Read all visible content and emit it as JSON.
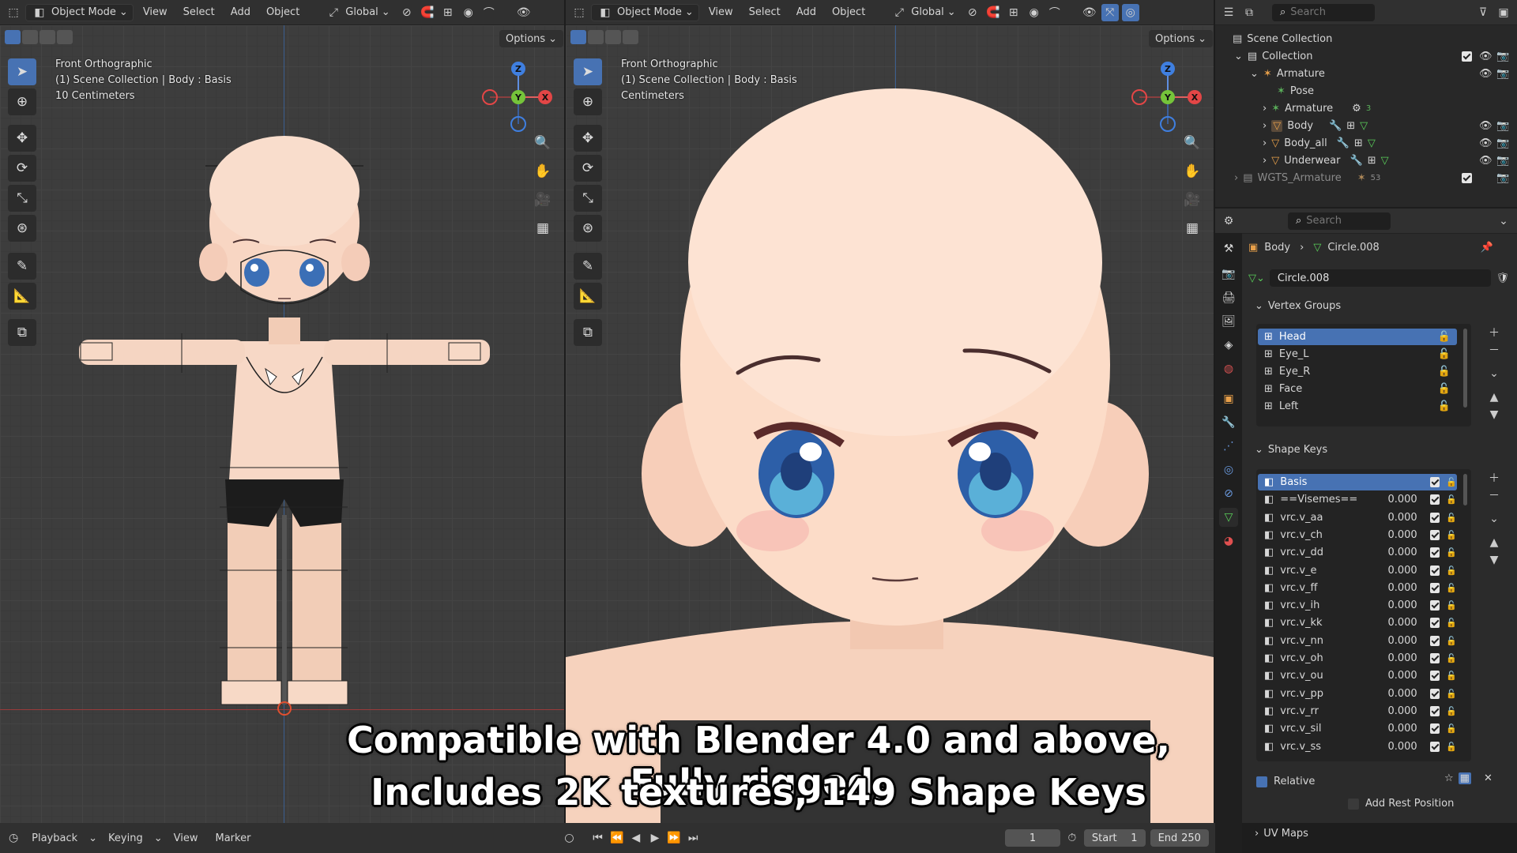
{
  "viewport_left": {
    "mode": "Object Mode",
    "menus": [
      "View",
      "Select",
      "Add",
      "Object"
    ],
    "orientation": "Global",
    "options_label": "Options",
    "overlay_lines": [
      "Front Orthographic",
      "(1) Scene Collection | Body : Basis",
      "10 Centimeters"
    ]
  },
  "viewport_right": {
    "mode": "Object Mode",
    "menus": [
      "View",
      "Select",
      "Add",
      "Object"
    ],
    "orientation": "Global",
    "options_label": "Options",
    "overlay_lines": [
      "Front Orthographic",
      "(1) Scene Collection | Body : Basis",
      "Centimeters"
    ]
  },
  "gizmo": {
    "z": "Z",
    "y": "Y",
    "x": "X"
  },
  "outliner": {
    "search_placeholder": "Search",
    "rows": [
      {
        "label": "Scene Collection",
        "icon": "scene-collection-icon"
      },
      {
        "label": "Collection",
        "icon": "collection-icon"
      },
      {
        "label": "Armature",
        "icon": "armature-icon"
      },
      {
        "label": "Pose",
        "icon": "pose-icon"
      },
      {
        "label": "Armature",
        "icon": "armature-data-icon",
        "badge": "3"
      },
      {
        "label": "Body",
        "icon": "mesh-icon"
      },
      {
        "label": "Body_all",
        "icon": "mesh-icon"
      },
      {
        "label": "Underwear",
        "icon": "mesh-icon"
      },
      {
        "label": "WGTS_Armature",
        "icon": "collection-icon",
        "badge": "53"
      }
    ]
  },
  "properties": {
    "search_placeholder": "Search",
    "breadcrumb_object": "Body",
    "breadcrumb_mesh": "Circle.008",
    "mesh_name": "Circle.008",
    "vertex_groups_title": "Vertex Groups",
    "vertex_groups": [
      "Head",
      "Eye_L",
      "Eye_R",
      "Face",
      "Left"
    ],
    "shape_keys_title": "Shape Keys",
    "shape_keys": [
      {
        "name": "Basis",
        "value": ""
      },
      {
        "name": "==Visemes==",
        "value": "0.000"
      },
      {
        "name": "vrc.v_aa",
        "value": "0.000"
      },
      {
        "name": "vrc.v_ch",
        "value": "0.000"
      },
      {
        "name": "vrc.v_dd",
        "value": "0.000"
      },
      {
        "name": "vrc.v_e",
        "value": "0.000"
      },
      {
        "name": "vrc.v_ff",
        "value": "0.000"
      },
      {
        "name": "vrc.v_ih",
        "value": "0.000"
      },
      {
        "name": "vrc.v_kk",
        "value": "0.000"
      },
      {
        "name": "vrc.v_nn",
        "value": "0.000"
      },
      {
        "name": "vrc.v_oh",
        "value": "0.000"
      },
      {
        "name": "vrc.v_ou",
        "value": "0.000"
      },
      {
        "name": "vrc.v_pp",
        "value": "0.000"
      },
      {
        "name": "vrc.v_rr",
        "value": "0.000"
      },
      {
        "name": "vrc.v_sil",
        "value": "0.000"
      },
      {
        "name": "vrc.v_ss",
        "value": "0.000"
      }
    ],
    "relative_label": "Relative",
    "add_rest_label": "Add Rest Position",
    "uv_maps_title": "UV Maps"
  },
  "timeline": {
    "menus": [
      "Playback",
      "Keying",
      "View",
      "Marker"
    ],
    "current_frame": "1",
    "start_label": "Start",
    "start_value": "1",
    "end_label": "End",
    "end_value": "250"
  },
  "caption": {
    "line1": "Compatible with Blender 4.0 and above, Fully rigged,",
    "line2": "Includes 2K textures, 149 Shape Keys"
  },
  "colors": {
    "selection": "#4772b3",
    "skin": "#fcdcc8",
    "eye": "#3a6fb8"
  }
}
